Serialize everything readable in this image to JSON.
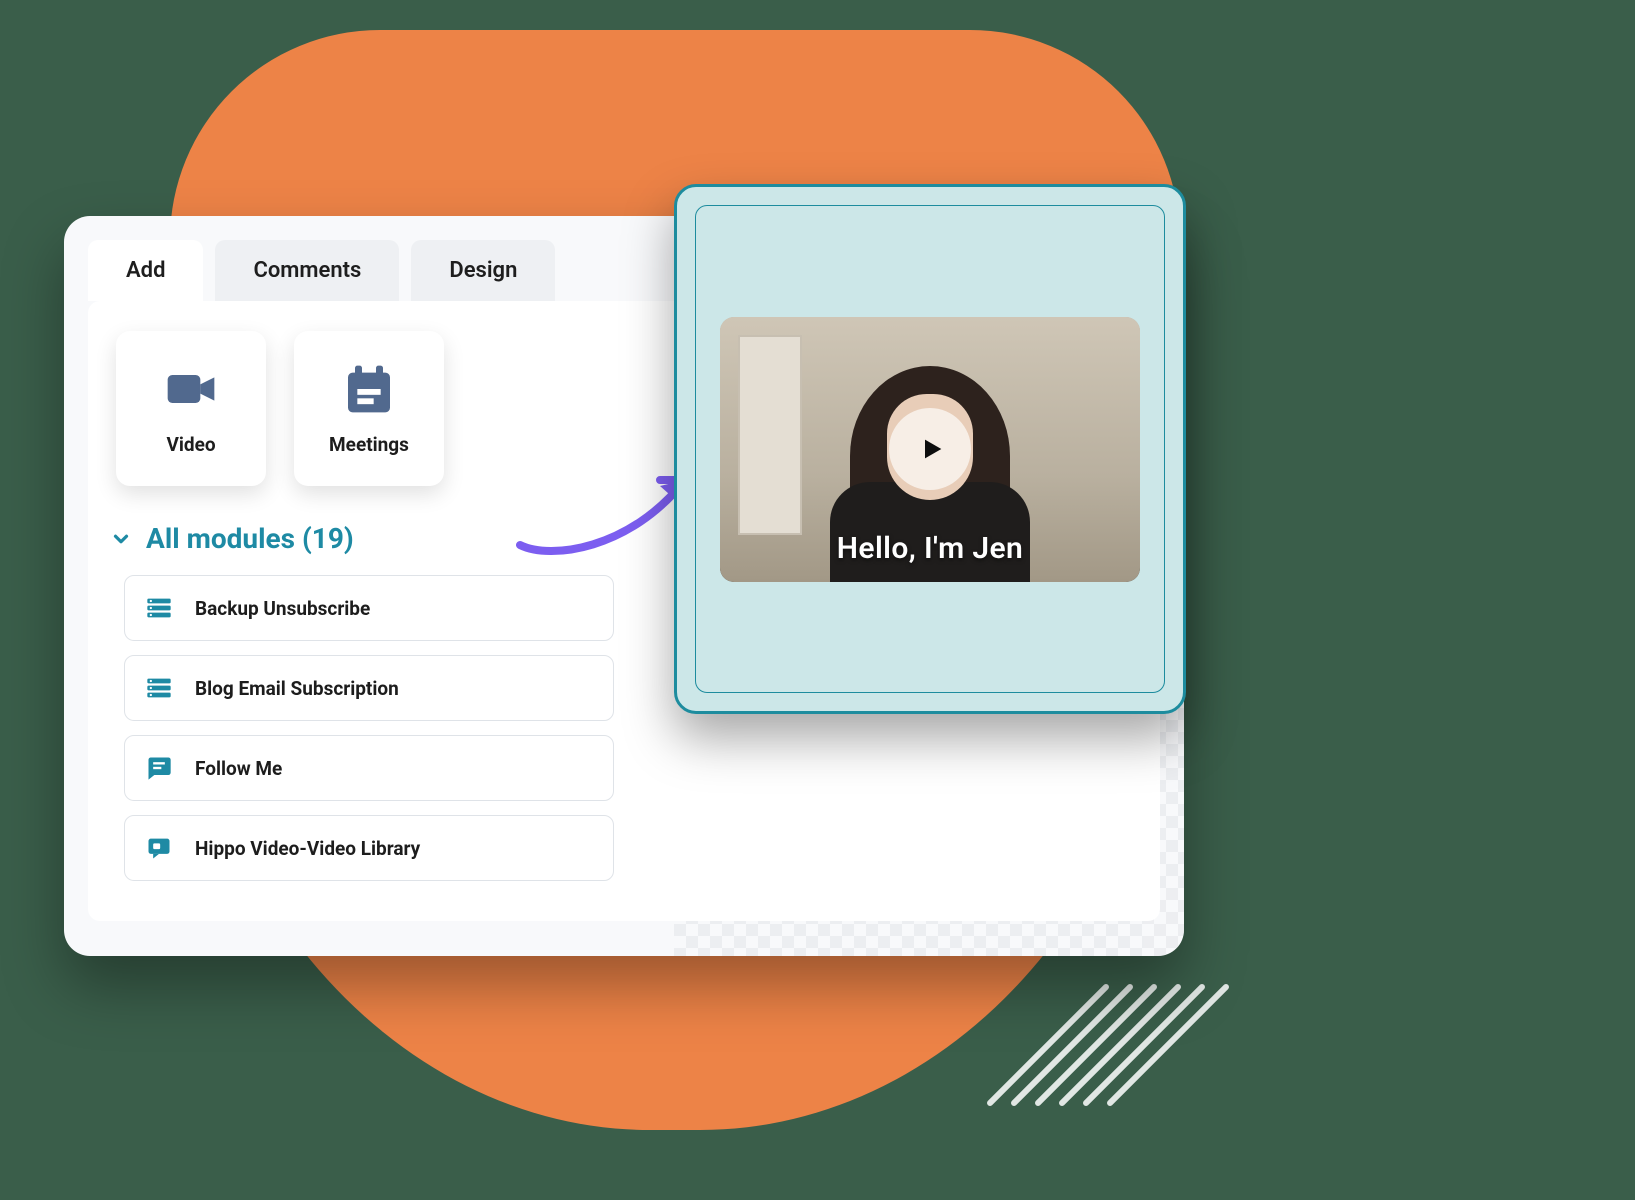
{
  "tabs": {
    "add": "Add",
    "comments": "Comments",
    "design": "Design"
  },
  "tiles": {
    "video": "Video",
    "meetings": "Meetings"
  },
  "section": {
    "title": "All modules (19)"
  },
  "modules": [
    {
      "label": "Backup Unsubscribe",
      "icon": "list"
    },
    {
      "label": "Blog Email Subscription",
      "icon": "list"
    },
    {
      "label": "Follow Me",
      "icon": "chat"
    },
    {
      "label": "Hippo Video-Video Library",
      "icon": "bubble"
    }
  ],
  "preview": {
    "caption": "Hello, I'm Jen"
  },
  "colors": {
    "accent": "#1e8aa4",
    "blob": "#ed8347",
    "previewBg": "#cce7e8",
    "arrow": "#7c5ef0"
  }
}
